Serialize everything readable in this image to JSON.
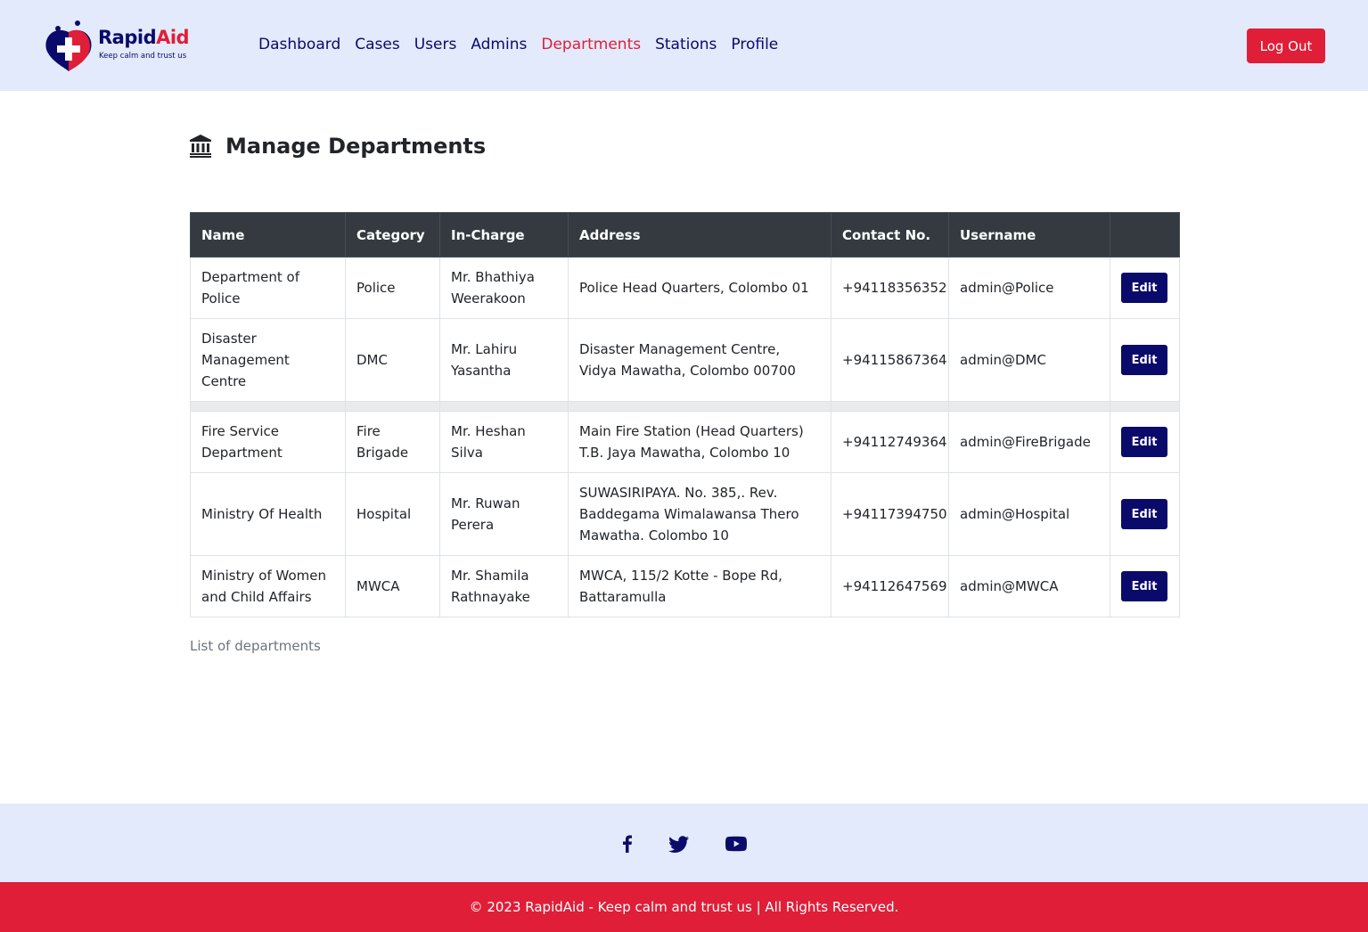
{
  "brand": {
    "name_part1": "Rapid",
    "name_part2": "Aid",
    "tagline": "Keep calm and trust us",
    "primary_color": "#0a0a6b",
    "accent_color": "#e01e37",
    "header_bg": "#e2eafc"
  },
  "nav": {
    "items": [
      {
        "label": "Dashboard",
        "active": false
      },
      {
        "label": "Cases",
        "active": false
      },
      {
        "label": "Users",
        "active": false
      },
      {
        "label": "Admins",
        "active": false
      },
      {
        "label": "Departments",
        "active": true
      },
      {
        "label": "Stations",
        "active": false
      },
      {
        "label": "Profile",
        "active": false
      }
    ],
    "logout_label": "Log Out"
  },
  "page": {
    "title": "Manage Departments",
    "icon": "bank-icon"
  },
  "table": {
    "headers": [
      "Name",
      "Category",
      "In-Charge",
      "Address",
      "Contact No.",
      "Username",
      ""
    ],
    "rows": [
      {
        "name": "Department of Police",
        "category": "Police",
        "in_charge": "Mr. Bhathiya Weerakoon",
        "address": "Police Head Quarters, Colombo 01",
        "contact": "+94118356352",
        "username": "admin@Police",
        "action": "Edit"
      },
      {
        "name": "Disaster Management Centre",
        "category": "DMC",
        "in_charge": "Mr. Lahiru Yasantha",
        "address": "Disaster Management Centre, Vidya Mawatha, Colombo 00700",
        "contact": "+94115867364",
        "username": "admin@DMC",
        "action": "Edit"
      },
      {
        "name": "Fire Service Department",
        "category": "Fire Brigade",
        "in_charge": "Mr. Heshan Silva",
        "address": "Main Fire Station (Head Quarters) T.B. Jaya Mawatha, Colombo 10",
        "contact": "+94112749364",
        "username": "admin@FireBrigade",
        "action": "Edit"
      },
      {
        "name": "Ministry Of Health",
        "category": "Hospital",
        "in_charge": "Mr. Ruwan Perera",
        "address": "SUWASIRIPAYA. No. 385,. Rev. Baddegama Wimalawansa Thero Mawatha. Colombo 10",
        "contact": "+94117394750",
        "username": "admin@Hospital",
        "action": "Edit"
      },
      {
        "name": "Ministry of Women and Child Affairs",
        "category": "MWCA",
        "in_charge": "Mr. Shamila Rathnayake",
        "address": "MWCA, 115/2 Kotte - Bope Rd, Battaramulla",
        "contact": "+94112647569",
        "username": "admin@MWCA",
        "action": "Edit"
      }
    ],
    "caption": "List of departments"
  },
  "footer": {
    "social_icons": [
      "facebook-icon",
      "twitter-icon",
      "youtube-icon"
    ],
    "copyright": "© 2023 RapidAid - Keep calm and trust us | All Rights Reserved."
  }
}
